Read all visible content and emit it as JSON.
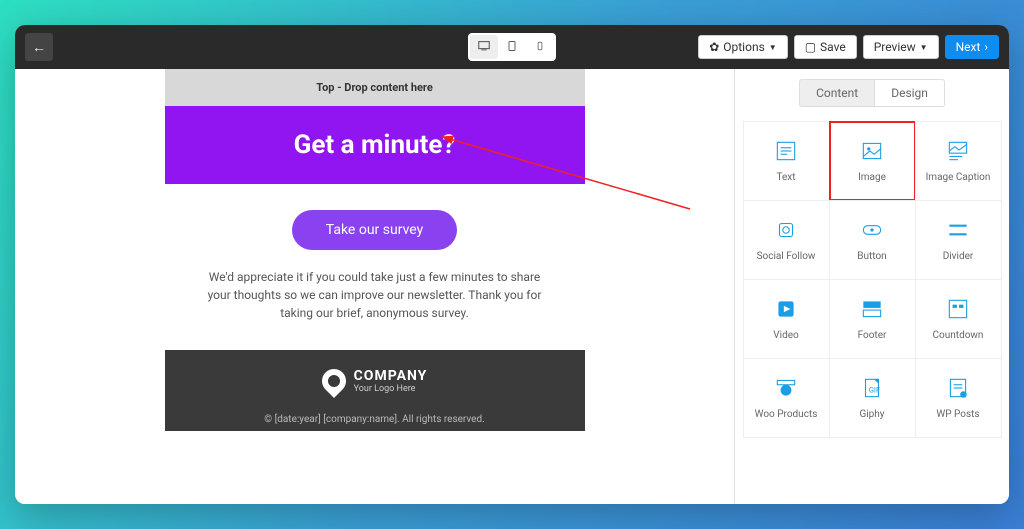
{
  "topbar": {
    "options": "Options",
    "save": "Save",
    "preview": "Preview",
    "next": "Next"
  },
  "canvas": {
    "drop_top": "Top - Drop content here",
    "headline": "Get a minute?",
    "cta": "Take our survey",
    "body": "We'd appreciate it if you could take just a few minutes to share your thoughts so we can improve our newsletter. Thank you for taking our brief, anonymous survey.",
    "company": "COMPANY",
    "tagline": "Your Logo Here",
    "copyright": "© [date:year] [company:name]. All rights reserved."
  },
  "panel": {
    "tab_content": "Content",
    "tab_design": "Design",
    "blocks": {
      "text": "Text",
      "image": "Image",
      "image_caption": "Image Caption",
      "social_follow": "Social Follow",
      "button": "Button",
      "divider": "Divider",
      "video": "Video",
      "footer": "Footer",
      "countdown": "Countdown",
      "woo": "Woo Products",
      "giphy": "Giphy",
      "wp_posts": "WP Posts"
    }
  }
}
